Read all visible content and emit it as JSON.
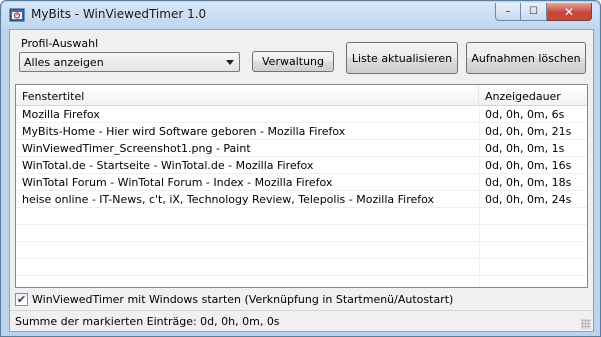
{
  "window": {
    "title": "MyBits - WinViewedTimer 1.0",
    "buttons": {
      "minimize": "–",
      "maximize": "☐",
      "close": "✕"
    }
  },
  "profile": {
    "label": "Profil-Auswahl",
    "selected": "Alles anzeigen"
  },
  "toolbar": {
    "verwaltung": "Verwaltung",
    "refresh": "Liste aktualisieren",
    "delete": "Aufnahmen löschen"
  },
  "table": {
    "columns": [
      "Fenstertitel",
      "Anzeigedauer"
    ],
    "rows": [
      {
        "title": "Mozilla Firefox",
        "duration": "0d, 0h, 0m, 6s"
      },
      {
        "title": "MyBits-Home - Hier wird Software geboren - Mozilla Firefox",
        "duration": "0d, 0h, 0m, 21s"
      },
      {
        "title": "WinViewedTimer_Screenshot1.png - Paint",
        "duration": "0d, 0h, 0m, 1s"
      },
      {
        "title": "WinTotal.de - Startseite - WinTotal.de - Mozilla Firefox",
        "duration": "0d, 0h, 0m, 16s"
      },
      {
        "title": "WinTotal Forum - WinTotal Forum - Index - Mozilla Firefox",
        "duration": "0d, 0h, 0m, 18s"
      },
      {
        "title": "heise online - IT-News, c't, iX, Technology Review, Telepolis - Mozilla Firefox",
        "duration": "0d, 0h, 0m, 24s"
      },
      {
        "title": "",
        "duration": ""
      },
      {
        "title": "",
        "duration": ""
      },
      {
        "title": "",
        "duration": ""
      },
      {
        "title": "",
        "duration": ""
      }
    ]
  },
  "autostart": {
    "checked": true,
    "label": "WinViewedTimer mit Windows starten (Verknüpfung in Startmenü/Autostart)"
  },
  "status": {
    "text": "Summe der markierten Einträge: 0d, 0h, 0m, 0s"
  },
  "colors": {
    "titlebar": "#c1d7ee",
    "close_button": "#c4473a",
    "client_bg": "#f0f0f0"
  }
}
